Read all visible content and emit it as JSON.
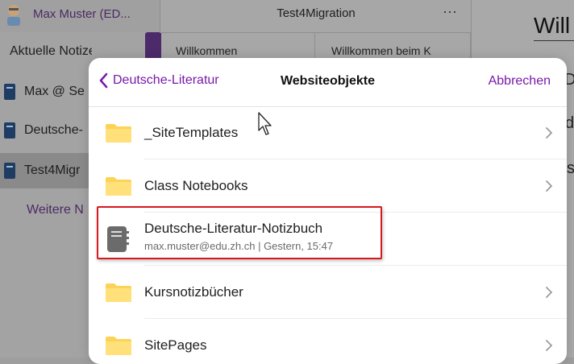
{
  "background": {
    "username": "Max Muster (ED...",
    "nav_items": [
      {
        "label": "Aktuelle Notizen",
        "icon": "clock-icon"
      },
      {
        "label": "Max @ Se",
        "icon": "notebook-icon"
      },
      {
        "label": "Deutsche-",
        "icon": "notebook-icon"
      },
      {
        "label": "Test4Migr",
        "icon": "notebook-icon"
      }
    ],
    "more_label": "Weitere N",
    "notebook_title": "Test4Migration",
    "menu_label": "···",
    "pages": [
      "Willkommen",
      "Willkommen beim K"
    ],
    "right_title": "Will",
    "right_frags": [
      "D",
      "d",
      "s"
    ]
  },
  "modal": {
    "back_label": "Deutsche-Literatur",
    "title": "Websiteobjekte",
    "cancel_label": "Abbrechen",
    "items": [
      {
        "type": "folder",
        "label": "_SiteTemplates",
        "icon": "folder-icon"
      },
      {
        "type": "folder",
        "label": "Class Notebooks",
        "icon": "folder-icon"
      },
      {
        "type": "notebook",
        "label": "Deutsche-Literatur-Notizbuch",
        "subtitle": "max.muster@edu.zh.ch | Gestern, 15:47",
        "icon": "notebook-icon"
      },
      {
        "type": "folder",
        "label": "Kursnotizbücher",
        "icon": "folder-icon"
      },
      {
        "type": "folder",
        "label": "SitePages",
        "icon": "folder-icon"
      }
    ]
  },
  "colors": {
    "accent": "#7719aa",
    "folder": "#fcd356",
    "highlight": "#d71920"
  }
}
